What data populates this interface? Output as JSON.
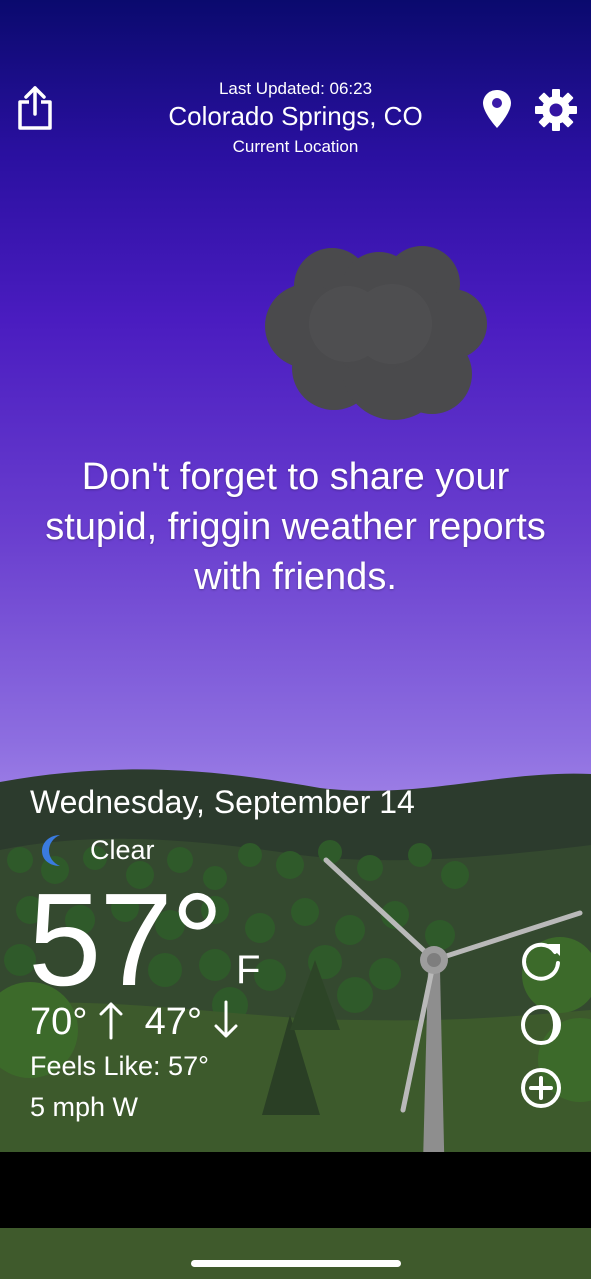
{
  "header": {
    "last_updated": "Last Updated: 06:23",
    "city": "Colorado Springs, CO",
    "location_label": "Current Location"
  },
  "icons": {
    "share": "share-icon",
    "location": "location-pin-icon",
    "settings": "gear-icon",
    "cloud": "cloud-icon",
    "condition": "moon-icon",
    "refresh": "refresh-icon",
    "theme": "moon-phase-icon",
    "add": "add-icon"
  },
  "message": "Don't forget to share your stupid, friggin weather reports with friends.",
  "weather": {
    "date": "Wednesday, September 14",
    "condition": "Clear",
    "temperature": "57°",
    "unit": "F",
    "high": "70°",
    "low": "47°",
    "feels_like": "Feels Like: 57°",
    "wind": "5 mph W"
  },
  "colors": {
    "sky_top": "#0a0a6e",
    "sky_bottom": "#c9b0f7",
    "hill_dark": "#2b3a2a",
    "hill_green": "#3f5a2c",
    "moon_blue": "#3a7be0"
  }
}
